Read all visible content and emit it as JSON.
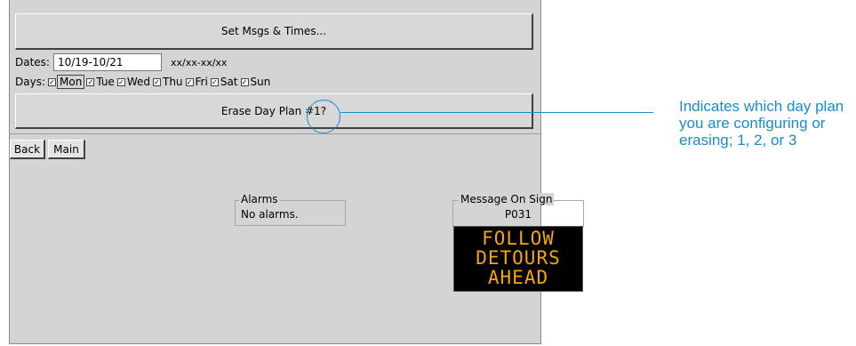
{
  "top_section": {
    "set_msgs_button": "Set Msgs & Times...",
    "dates_label": "Dates:",
    "dates_value": "10/19-10/21",
    "dates_hint": "xx/xx-xx/xx",
    "days_label": "Days:",
    "days": [
      {
        "label": "Mon",
        "checked": true
      },
      {
        "label": "Tue",
        "checked": true
      },
      {
        "label": "Wed",
        "checked": true
      },
      {
        "label": "Thu",
        "checked": true
      },
      {
        "label": "Fri",
        "checked": true
      },
      {
        "label": "Sat",
        "checked": true
      },
      {
        "label": "Sun",
        "checked": true
      }
    ],
    "erase_button": "Erase Day Plan #1?",
    "check_glyph": "☑"
  },
  "nav": {
    "back": "Back",
    "main": "Main"
  },
  "alarms": {
    "legend": "Alarms",
    "text": "No alarms."
  },
  "message_on_sign": {
    "legend": "Message On Sign",
    "code": "P031",
    "lines": [
      "FOLLOW",
      "DETOURS",
      "AHEAD"
    ],
    "text_color": "#f3a800"
  },
  "annotation": {
    "text": "Indicates which day plan you are configuring or erasing; 1, 2, or 3",
    "color": "#1a8bd0"
  }
}
